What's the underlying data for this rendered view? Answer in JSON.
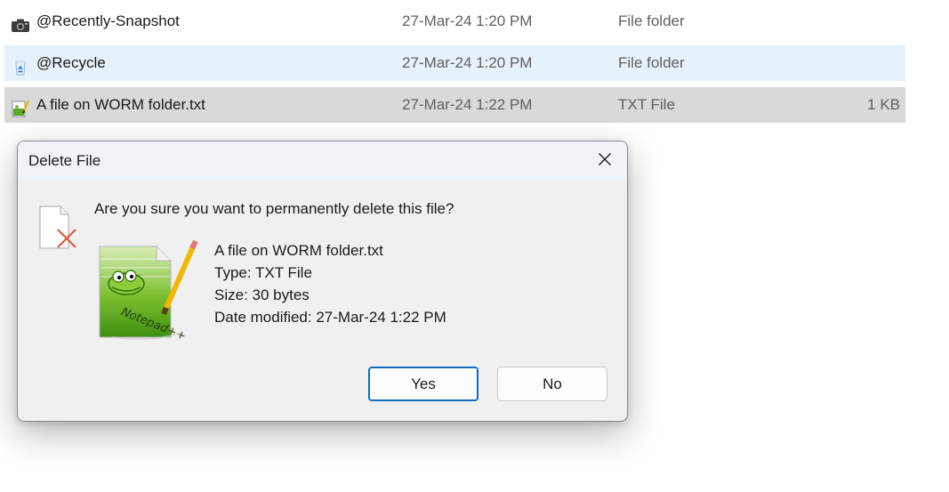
{
  "files": [
    {
      "name": "@Recently-Snapshot",
      "date": "27-Mar-24 1:20 PM",
      "type": "File folder",
      "size": "",
      "icon": "camera-icon",
      "state": "normal"
    },
    {
      "name": "@Recycle",
      "date": "27-Mar-24 1:20 PM",
      "type": "File folder",
      "size": "",
      "icon": "recycle-icon",
      "state": "hover"
    },
    {
      "name": "A file on WORM folder.txt",
      "date": "27-Mar-24 1:22 PM",
      "type": "TXT File",
      "size": "1 KB",
      "icon": "notepad-file-icon",
      "state": "selected"
    }
  ],
  "dialog": {
    "title": "Delete File",
    "question": "Are you sure you want to permanently delete this file?",
    "file_name": "A file on WORM folder.txt",
    "file_type": "Type: TXT File",
    "file_size": "Size: 30 bytes",
    "date_modified": "Date modified: 27-Mar-24 1:22 PM",
    "yes_label": "Yes",
    "no_label": "No"
  },
  "colors": {
    "hover_row": "#e5f1fb",
    "selected_row": "#d9d9d9",
    "dialog_bg": "#f0f0f0",
    "titlebar_bg": "#f0f4f9",
    "primary_border": "#0f6cbd",
    "delete_x": "#e0532c"
  }
}
